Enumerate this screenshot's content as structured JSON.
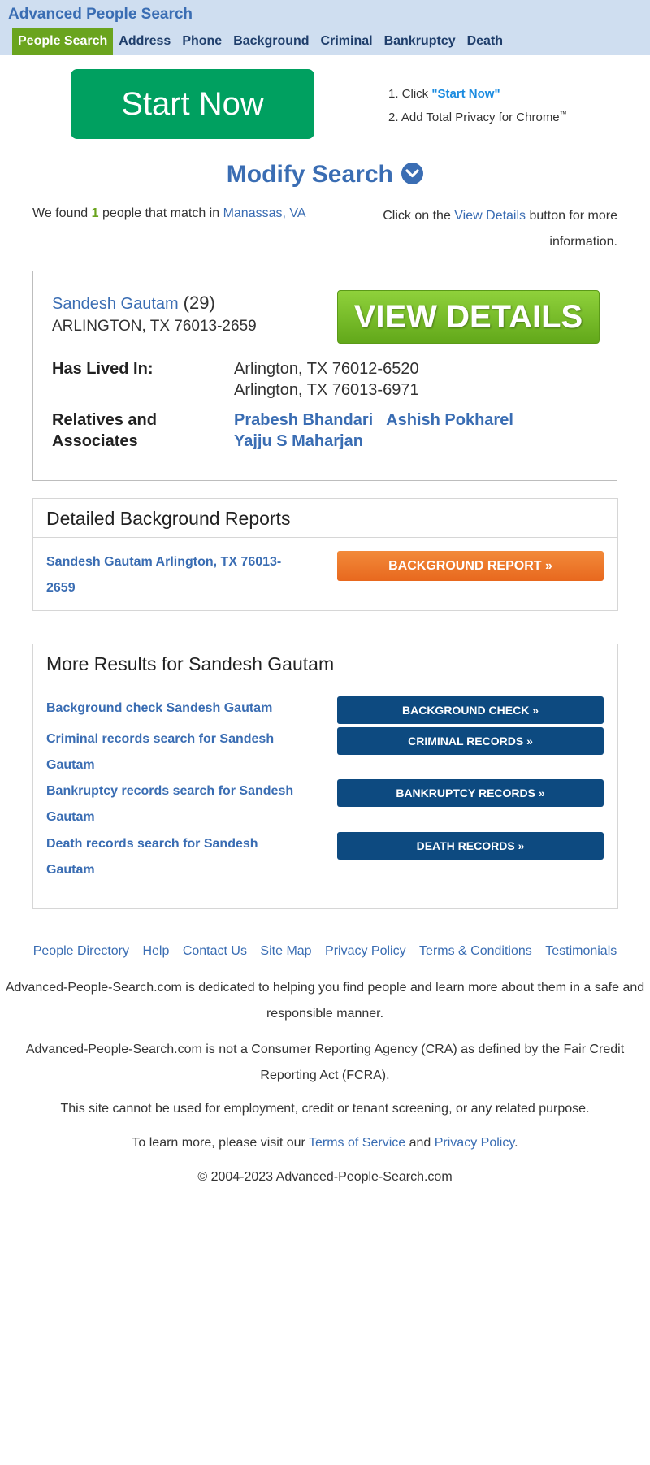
{
  "header": {
    "site_title": "Advanced People Search",
    "nav": [
      "People Search",
      "Address",
      "Phone",
      "Background",
      "Criminal",
      "Bankruptcy",
      "Death"
    ]
  },
  "promo": {
    "start_button": "Start Now",
    "step1_prefix": "1. Click ",
    "step1_highlight": "\"Start Now\"",
    "step2": "2. Add Total Privacy for Chrome",
    "step2_tm": "™"
  },
  "modify_search": "Modify Search",
  "summary": {
    "found_prefix": "We found",
    "found_count": "1",
    "found_suffix": "people that match in",
    "location": "Manassas, VA",
    "click_prefix": "Click on the",
    "click_link": "View Details",
    "click_suffix": "button for more information."
  },
  "result": {
    "name": "Sandesh Gautam",
    "age": "(29)",
    "address": "ARLINGTON, TX 76013-2659",
    "view_details": "VIEW DETAILS",
    "lived_label": "Has Lived In:",
    "lived": [
      "Arlington, TX 76012-6520",
      "Arlington, TX 76013-6971"
    ],
    "relatives_label": "Relatives and Associates",
    "relatives": [
      "Prabesh Bhandari",
      "Ashish Pokharel",
      "Yajju S Maharjan"
    ]
  },
  "background_panel": {
    "title": "Detailed Background Reports",
    "row_text": "Sandesh Gautam Arlington, TX 76013-2659",
    "button": "BACKGROUND REPORT »"
  },
  "more_panel": {
    "title": "More Results for Sandesh Gautam",
    "rows": [
      {
        "text": "Background check Sandesh Gautam",
        "button": "BACKGROUND CHECK »"
      },
      {
        "text": "Criminal records search for Sandesh Gautam",
        "button": "CRIMINAL RECORDS »"
      },
      {
        "text": "Bankruptcy records search for Sandesh Gautam",
        "button": "BANKRUPTCY RECORDS »"
      },
      {
        "text": "Death records search for Sandesh Gautam",
        "button": "DEATH RECORDS »"
      }
    ]
  },
  "footer": {
    "links": [
      "People Directory",
      "Help",
      "Contact Us",
      "Site Map",
      "Privacy Policy",
      "Terms & Conditions",
      "Testimonials"
    ],
    "p1": "Advanced-People-Search.com is dedicated to helping you find people and learn more about them in a safe and responsible manner.",
    "p2": "Advanced-People-Search.com is not a Consumer Reporting Agency (CRA) as defined by the Fair Credit Reporting Act (FCRA).",
    "p3": "This site cannot be used for employment, credit or tenant screening, or any related purpose.",
    "p4_prefix": "To learn more, please visit our",
    "p4_link1": "Terms of Service",
    "p4_and": "and",
    "p4_link2": "Privacy Policy",
    "p4_end": ".",
    "copyright": "© 2004-2023 Advanced-People-Search.com"
  }
}
